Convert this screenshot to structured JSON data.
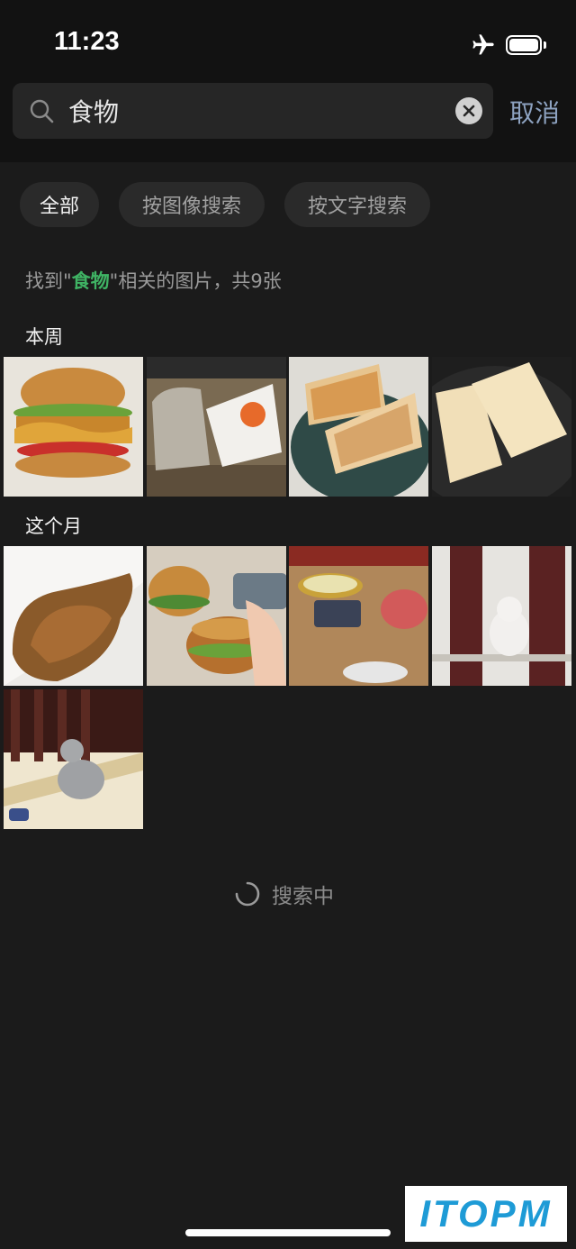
{
  "status_bar": {
    "time": "11:23"
  },
  "search": {
    "query": "食物",
    "cancel_label": "取消"
  },
  "filters": [
    {
      "label": "全部",
      "active": true
    },
    {
      "label": "按图像搜索",
      "active": false
    },
    {
      "label": "按文字搜索",
      "active": false
    }
  ],
  "results": {
    "prefix": "找到\"",
    "keyword": "食物",
    "suffix": "\"相关的图片，共9张"
  },
  "sections": [
    {
      "title": "本周",
      "photos": [
        "burger-poster",
        "burger-king-bag",
        "toast-on-plate",
        "toast-in-pan"
      ]
    },
    {
      "title": "这个月",
      "photos": [
        "roast-chicken",
        "burgers-in-hand",
        "hotpot-table",
        "white-cat-by-railing",
        "gray-cat-on-stairs"
      ]
    }
  ],
  "loading": {
    "text": "搜索中"
  },
  "watermark": {
    "text": "ITOPM"
  },
  "colors": {
    "accent_green": "#3fb364",
    "cancel_blue": "#8da2c0"
  }
}
